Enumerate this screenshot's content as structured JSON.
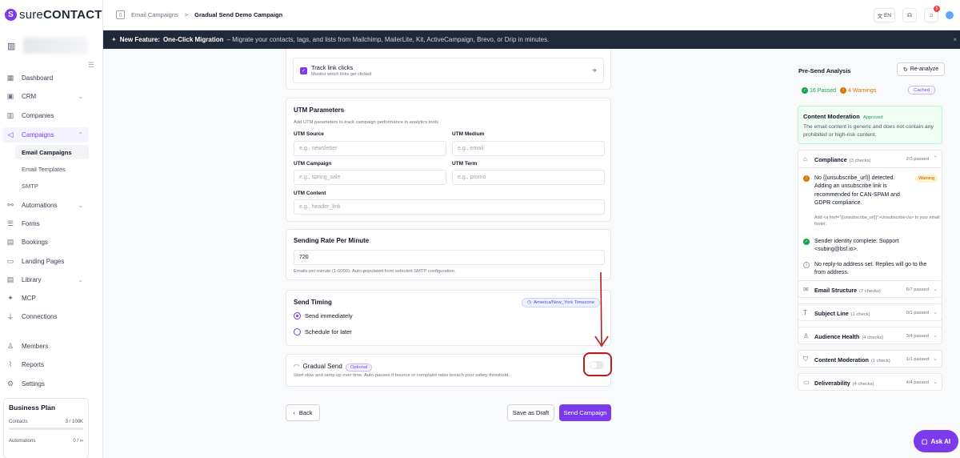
{
  "app": {
    "logo_mark": "S",
    "logo_prefix": "sure",
    "logo_suffix": "CONTACT"
  },
  "sidebar": {
    "items": [
      {
        "label": "Dashboard",
        "icon": "dashboard-icon"
      },
      {
        "label": "CRM",
        "icon": "crm-icon"
      },
      {
        "label": "Companies",
        "icon": "building-icon"
      },
      {
        "label": "Campaigns",
        "icon": "megaphone-icon"
      },
      {
        "label": "Automations",
        "icon": "automation-icon"
      },
      {
        "label": "Forms",
        "icon": "form-icon"
      },
      {
        "label": "Bookings",
        "icon": "calendar-icon"
      },
      {
        "label": "Landing Pages",
        "icon": "layout-icon"
      },
      {
        "label": "Library",
        "icon": "library-icon"
      },
      {
        "label": "MCP",
        "icon": "mcp-icon"
      },
      {
        "label": "Connections",
        "icon": "plug-icon"
      },
      {
        "label": "Members",
        "icon": "users-icon"
      },
      {
        "label": "Reports",
        "icon": "chart-icon"
      },
      {
        "label": "Settings",
        "icon": "gear-icon"
      }
    ],
    "sub_items": [
      "Email Campaigns",
      "Email Templates",
      "SMTP"
    ],
    "plan": {
      "title": "Business Plan",
      "contacts_label": "Contacts",
      "contacts_value": "3 / 100K",
      "automations_label": "Automations",
      "automations_value": "0 / ∞"
    }
  },
  "topbar": {
    "crumb_root": "Email Campaigns",
    "crumb_sep": ">",
    "crumb_current": "Gradual Send Demo Campaign",
    "lang": "EN",
    "notif_count": "5"
  },
  "banner": {
    "prefix": "New Feature:",
    "bold": "One-Click Migration",
    "text": "– Migrate your contacts, tags, and lists from Mailchimp, MailerLite, Kit, ActiveCampaign, Brevo, or Drip in minutes."
  },
  "track": {
    "title": "Track link clicks",
    "sub": "Monitor which links get clicked"
  },
  "utm": {
    "title": "UTM Parameters",
    "helper": "Add UTM parameters to track campaign performance in analytics tools",
    "source_label": "UTM Source",
    "source_ph": "e.g., newsletter",
    "medium_label": "UTM Medium",
    "medium_ph": "e.g., email",
    "campaign_label": "UTM Campaign",
    "campaign_ph": "e.g., spring_sale",
    "term_label": "UTM Term",
    "term_ph": "e.g., promo",
    "content_label": "UTM Content",
    "content_ph": "e.g., header_link"
  },
  "rate": {
    "title": "Sending Rate Per Minute",
    "value": "720",
    "helper": "Emails per minute (1-6000). Auto-populated from selected SMTP configuration."
  },
  "timing": {
    "title": "Send Timing",
    "timezone": "America/New_York Timezone",
    "opt_immediate": "Send immediately",
    "opt_later": "Schedule for later"
  },
  "gradual": {
    "title": "Gradual Send",
    "badge": "Optional",
    "helper": "Start slow and ramp up over time. Auto-pauses if bounce or complaint rates breach your safety threshold.",
    "enabled": false
  },
  "actions": {
    "back": "Back",
    "draft": "Save as Draft",
    "send": "Send Campaign"
  },
  "analysis": {
    "title": "Pre-Send Analysis",
    "reanalyze": "Re-analyze",
    "passed": "16 Passed",
    "warnings": "4 Warnings",
    "cached": "Cached",
    "moderation": {
      "title": "Content Moderation",
      "status": "Approved",
      "text": "The email content is generic and does not contain any prohibited or high-risk content."
    },
    "compliance": {
      "name": "Compliance",
      "count": "(3 checks)",
      "pass": "2/3 passed",
      "items": [
        {
          "text": "No {{unsubscribe_url}} detected. Adding an unsubscribe link is recommended for CAN-SPAM and GDPR compliance.",
          "sub": "Add <a href=\"{{unsubscribe_url}}\">Unsubscribe</a> to your email footer.",
          "badge": "Warning"
        },
        {
          "text": "Sender identity complete: Support <subing@bsf.io>."
        },
        {
          "text": "No reply-to address set. Replies will go to the from address."
        }
      ]
    },
    "sections": [
      {
        "name": "Email Structure",
        "count": "(7 checks)",
        "pass": "6/7 passed",
        "icon": "envelope-icon"
      },
      {
        "name": "Subject Line",
        "count": "(1 check)",
        "pass": "0/1 passed",
        "icon": "text-icon"
      },
      {
        "name": "Audience Health",
        "count": "(4 checks)",
        "pass": "3/4 passed",
        "icon": "users-icon"
      },
      {
        "name": "Content Moderation",
        "count": "(1 check)",
        "pass": "1/1 passed",
        "icon": "shield-icon"
      },
      {
        "name": "Deliverability",
        "count": "(4 checks)",
        "pass": "4/4 passed",
        "icon": "inbox-icon"
      }
    ]
  },
  "ask_ai": "Ask AI",
  "colors": {
    "accent": "#7c3aed",
    "success": "#16a34a",
    "warning": "#d97706",
    "annotation": "#b91c1c"
  }
}
